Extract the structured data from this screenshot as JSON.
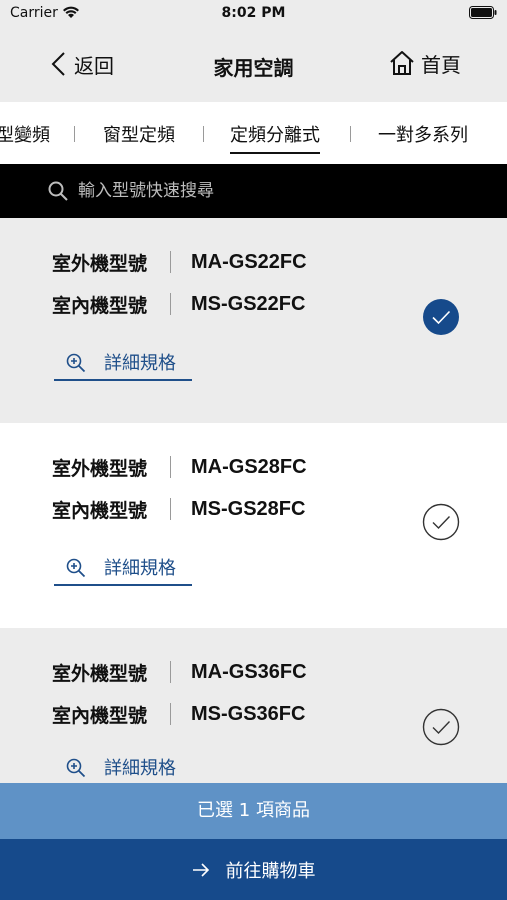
{
  "status_bar": {
    "carrier": "Carrier",
    "time": "8:02 PM"
  },
  "nav": {
    "back_label": "返回",
    "title": "家用空調",
    "home_label": "首頁"
  },
  "tabs": [
    {
      "label": "型變頻"
    },
    {
      "label": "窗型定頻"
    },
    {
      "label": "定頻分離式"
    },
    {
      "label": "一對多系列"
    }
  ],
  "search": {
    "placeholder": "輸入型號快速搜尋"
  },
  "products": [
    {
      "outdoor_label": "室外機型號",
      "outdoor_model": "MA-GS22FC",
      "indoor_label": "室內機型號",
      "indoor_model": "MS-GS22FC",
      "spec_label": "詳細規格",
      "selected": true
    },
    {
      "outdoor_label": "室外機型號",
      "outdoor_model": "MA-GS28FC",
      "indoor_label": "室內機型號",
      "indoor_model": "MS-GS28FC",
      "spec_label": "詳細規格",
      "selected": false
    },
    {
      "outdoor_label": "室外機型號",
      "outdoor_model": "MA-GS36FC",
      "indoor_label": "室內機型號",
      "indoor_model": "MS-GS36FC",
      "spec_label": "詳細規格",
      "selected": false
    }
  ],
  "selection": {
    "summary": "已選 1 項商品"
  },
  "cart": {
    "label": "前往購物車"
  },
  "colors": {
    "accent": "#164a8b",
    "summary_bar": "#5f92c6",
    "panel_gray": "#ececec"
  }
}
